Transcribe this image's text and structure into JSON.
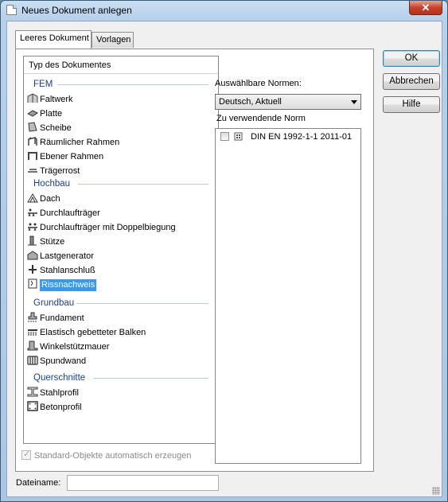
{
  "window": {
    "title": "Neues Dokument anlegen",
    "close_symbol": "✕"
  },
  "tabs": [
    {
      "label": "Leeres Dokument",
      "active": true
    },
    {
      "label": "Vorlagen",
      "active": false
    }
  ],
  "doc_list": {
    "header": "Typ des Dokumentes",
    "groups": [
      {
        "label": "FEM",
        "items": [
          {
            "label": "Faltwerk",
            "icon": "faltwerk-icon"
          },
          {
            "label": "Platte",
            "icon": "platte-icon"
          },
          {
            "label": "Scheibe",
            "icon": "scheibe-icon"
          },
          {
            "label": "Räumlicher Rahmen",
            "icon": "raeumlicher-rahmen-icon"
          },
          {
            "label": "Ebener Rahmen",
            "icon": "ebener-rahmen-icon"
          },
          {
            "label": "Trägerrost",
            "icon": "traegerrost-icon"
          }
        ]
      },
      {
        "label": "Hochbau",
        "items": [
          {
            "label": "Dach",
            "icon": "dach-icon"
          },
          {
            "label": "Durchlaufträger",
            "icon": "durchlauftraeger-icon"
          },
          {
            "label": "Durchlaufträger mit Doppelbiegung",
            "icon": "doppelbiegung-icon"
          },
          {
            "label": "Stütze",
            "icon": "stuetze-icon"
          },
          {
            "label": "Lastgenerator",
            "icon": "lastgenerator-icon"
          },
          {
            "label": "Stahlanschluß",
            "icon": "stahlanschluss-icon"
          },
          {
            "label": "Rissnachweis",
            "icon": "rissnachweis-icon",
            "selected": true
          }
        ]
      },
      {
        "label": "Grundbau",
        "items": [
          {
            "label": "Fundament",
            "icon": "fundament-icon"
          },
          {
            "label": "Elastisch gebetteter Balken",
            "icon": "balken-icon"
          },
          {
            "label": "Winkelstützmauer",
            "icon": "winkelstuetzmauer-icon"
          },
          {
            "label": "Spundwand",
            "icon": "spundwand-icon"
          }
        ]
      },
      {
        "label": "Querschnitte",
        "items": [
          {
            "label": "Stahlprofil",
            "icon": "stahlprofil-icon"
          },
          {
            "label": "Betonprofil",
            "icon": "betonprofil-icon"
          }
        ]
      }
    ]
  },
  "norms": {
    "available_label": "Auswählbare Normen:",
    "selected_value": "Deutsch, Aktuell",
    "to_use_label": "Zu verwendende Norm",
    "items": [
      {
        "label": "DIN EN 1992-1-1 2011-01",
        "checked": false
      }
    ]
  },
  "buttons": {
    "ok": "OK",
    "cancel": "Abbrechen",
    "help": "Hilfe"
  },
  "options": {
    "auto_create_label": "Standard-Objekte automatisch erzeugen",
    "auto_create_checked": true
  },
  "filename": {
    "label": "Dateiname:",
    "value": ""
  }
}
